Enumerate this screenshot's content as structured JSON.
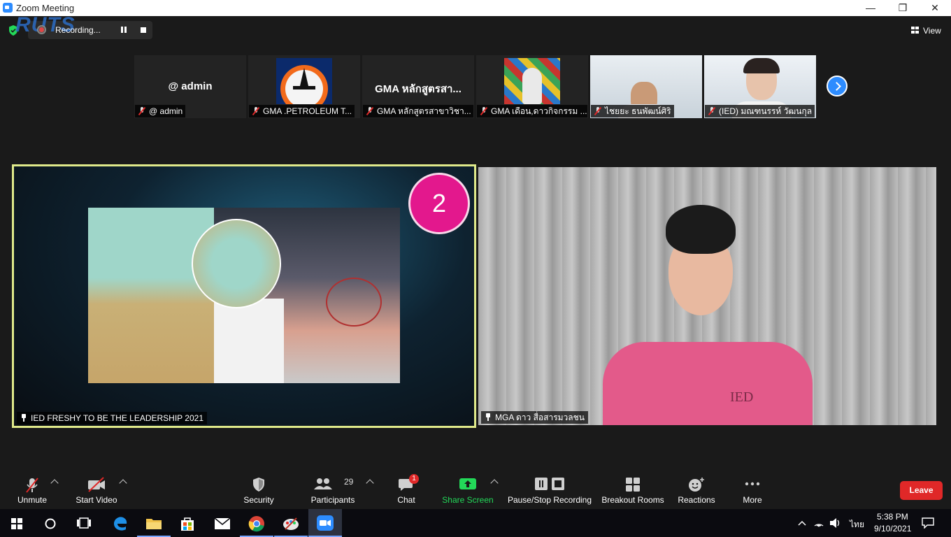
{
  "window": {
    "title": "Zoom Meeting",
    "controls": {
      "minimize": "—",
      "maximize": "❐",
      "close": "✕"
    }
  },
  "meeting_bar": {
    "recording_label": "Recording...",
    "view_label": "View",
    "watermark": "RUTS"
  },
  "gallery": [
    {
      "big_text": "@ admin",
      "label": "@ admin"
    },
    {
      "big_text": "",
      "label": "GMA .PETROLEUM T..."
    },
    {
      "big_text": "GMA หลักสูตรสา...",
      "label": "GMA หลักสูตรสาขาวิชา..."
    },
    {
      "big_text": "",
      "label": "GMA เดือน,ดาวกิจกรรม ..."
    },
    {
      "big_text": "",
      "label": "ไชยยะ ธนพัฒน์ศิริ"
    },
    {
      "big_text": "",
      "label": "(IED) มณฑนรรห์ วัฒนกุล"
    }
  ],
  "main_tiles": {
    "left": {
      "label": "IED FRESHY TO BE THE LEADERSHIP 2021",
      "badge": "2"
    },
    "right": {
      "label": "MGA ดาว สื่อสารมวลชน",
      "shirt_text": "IED"
    }
  },
  "toolbar": {
    "unmute": "Unmute",
    "start_video": "Start Video",
    "security": "Security",
    "participants": "Participants",
    "participants_count": "29",
    "chat": "Chat",
    "chat_badge": "1",
    "share_screen": "Share Screen",
    "pause_stop_recording": "Pause/Stop Recording",
    "breakout_rooms": "Breakout Rooms",
    "reactions": "Reactions",
    "more": "More",
    "leave": "Leave"
  },
  "taskbar": {
    "ime": "ไทย",
    "time": "5:38 PM",
    "date": "9/10/2021"
  },
  "colors": {
    "zoom_blue": "#2d8cff",
    "share_green": "#23d959",
    "leave_red": "#e02828",
    "active_speaker_border": "#dfe98a",
    "chat_badge": "#e02828",
    "badge_pink": "#e3188d"
  },
  "icons": [
    "zoom-logo-icon",
    "shield-check-icon",
    "record-icon",
    "pause-icon",
    "stop-icon",
    "grid-view-icon",
    "mic-muted-icon",
    "chevron-right-icon",
    "pin-icon",
    "video-off-icon",
    "security-icon",
    "participants-icon",
    "chat-icon",
    "share-screen-icon",
    "breakout-icon",
    "reactions-icon",
    "more-icon",
    "windows-start-icon",
    "search-icon",
    "task-view-icon",
    "edge-icon",
    "file-explorer-icon",
    "store-icon",
    "mail-icon",
    "chrome-icon",
    "paint-icon",
    "zoom-taskbar-icon",
    "notification-icon"
  ]
}
